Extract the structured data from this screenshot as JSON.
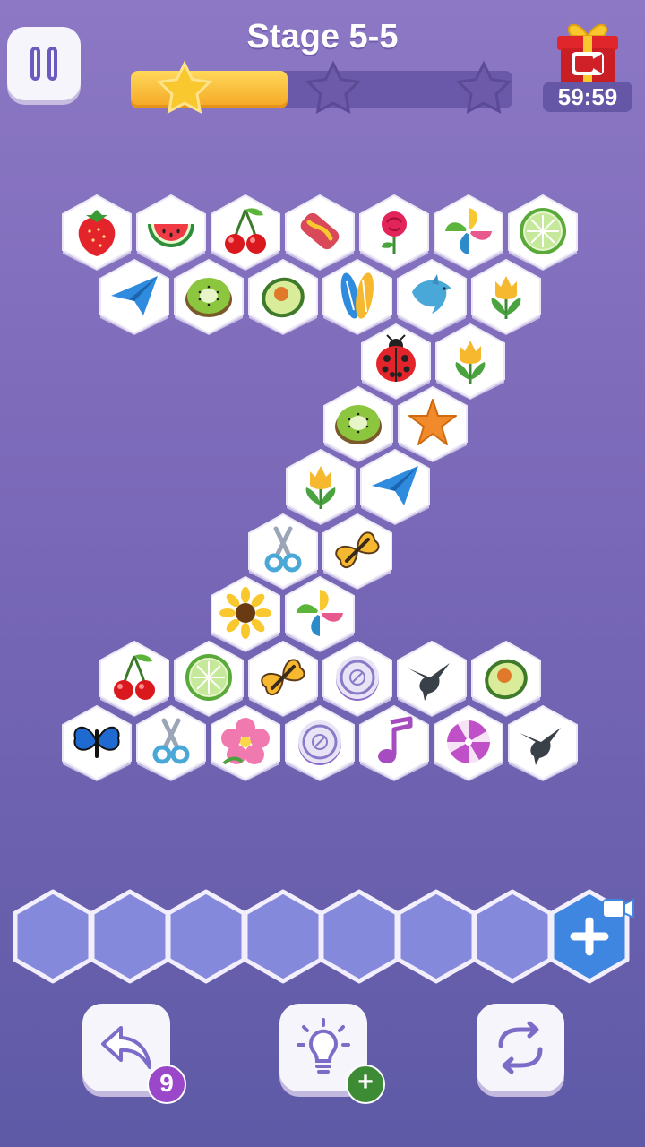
{
  "header": {
    "stage_title": "Stage 5-5",
    "progress_fraction": 0.41,
    "stars_earned": 1,
    "stars_total": 3,
    "timer": "59:59"
  },
  "colors": {
    "accent": "#6b5bbf",
    "star_gold": "#f8c82e",
    "progress_fill": "#f5a623",
    "slot_fill": "#8589db",
    "gift_red": "#e0262b"
  },
  "board": {
    "tiles": [
      {
        "icon": "strawberry-icon"
      },
      {
        "icon": "watermelon-icon"
      },
      {
        "icon": "cherry-icon"
      },
      {
        "icon": "candy-bar-icon"
      },
      {
        "icon": "rose-icon"
      },
      {
        "icon": "pinwheel-icon"
      },
      {
        "icon": "lime-slice-icon"
      },
      {
        "icon": "paper-plane-icon"
      },
      {
        "icon": "kiwi-icon"
      },
      {
        "icon": "avocado-icon"
      },
      {
        "icon": "surfboard-icon"
      },
      {
        "icon": "dolphin-icon"
      },
      {
        "icon": "tulip-icon"
      },
      {
        "icon": "ladybug-icon"
      },
      {
        "icon": "tulip-icon"
      },
      {
        "icon": "kiwi-icon"
      },
      {
        "icon": "starfish-icon"
      },
      {
        "icon": "tulip-icon"
      },
      {
        "icon": "paper-plane-icon"
      },
      {
        "icon": "scissors-icon"
      },
      {
        "icon": "butterfly-icon"
      },
      {
        "icon": "sunflower-icon"
      },
      {
        "icon": "pinwheel-icon"
      },
      {
        "icon": "cherry-icon"
      },
      {
        "icon": "lime-slice-icon"
      },
      {
        "icon": "butterfly-icon"
      },
      {
        "icon": "button-icon"
      },
      {
        "icon": "hummingbird-icon"
      },
      {
        "icon": "avocado-icon"
      },
      {
        "icon": "blue-butterfly-icon"
      },
      {
        "icon": "scissors-icon"
      },
      {
        "icon": "hibiscus-icon"
      },
      {
        "icon": "button-icon"
      },
      {
        "icon": "music-note-icon"
      },
      {
        "icon": "lollipop-icon"
      },
      {
        "icon": "hummingbird-icon"
      }
    ]
  },
  "tray": {
    "empty_slots": 7,
    "add_slot_icon": "plus-video-icon"
  },
  "tools": {
    "undo_count": "9",
    "hint_badge_icon": "plus-icon",
    "shuffle_icon": "shuffle-icon"
  }
}
